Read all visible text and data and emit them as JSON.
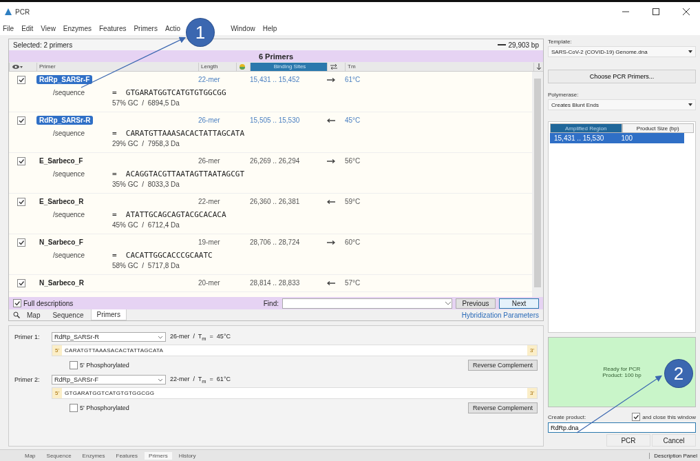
{
  "window": {
    "title": "PCR"
  },
  "menu": [
    "File",
    "Edit",
    "View",
    "Enzymes",
    "Features",
    "Primers",
    "Actio",
    "Window",
    "Help"
  ],
  "primer_list": {
    "selection": "Selected: 2 primers",
    "sequence_length": "29,903 bp",
    "heading": "6 Primers",
    "columns": [
      {
        "label": "Primer",
        "selected": false
      },
      {
        "label": "Length",
        "selected": false
      },
      {
        "label": "Binding Sites",
        "selected": true
      },
      {
        "label": "Tm",
        "selected": false
      }
    ],
    "rows": [
      {
        "name": "RdRp_SARSr-F",
        "selected": true,
        "checked": true,
        "length": "22-mer",
        "sites": "15,431 .. 15,452",
        "kind": "forward",
        "tm": "61°C",
        "sequence_label": "/sequence",
        "sequence": "=  GTGARATGGTCATGTGTGGCGG",
        "composition": "57% GC  /  6894,5 Da"
      },
      {
        "name": "RdRp_SARSr-R",
        "selected": true,
        "checked": true,
        "length": "26-mer",
        "sites": "15,505 .. 15,530",
        "kind": "reverse",
        "tm": "45°C",
        "sequence_label": "/sequence",
        "sequence": "=  CARATGTTAAASACACTATTAGCATA",
        "composition": "29% GC  /  7958,3 Da"
      },
      {
        "name": "E_Sarbeco_F",
        "selected": false,
        "checked": true,
        "length": "26-mer",
        "sites": "26,269 .. 26,294",
        "kind": "forward",
        "tm": "56°C",
        "sequence_label": "/sequence",
        "sequence": "=  ACAGGTACGTTAATAGTTAATAGCGT",
        "composition": "35% GC  /  8033,3 Da"
      },
      {
        "name": "E_Sarbeco_R",
        "selected": false,
        "checked": true,
        "length": "22-mer",
        "sites": "26,360 .. 26,381",
        "kind": "reverse",
        "tm": "59°C",
        "sequence_label": "/sequence",
        "sequence": "=  ATATTGCAGCAGTACGCACACA",
        "composition": "45% GC  /  6712,4 Da"
      },
      {
        "name": "N_Sarbeco_F",
        "selected": false,
        "checked": true,
        "length": "19-mer",
        "sites": "28,706 .. 28,724",
        "kind": "forward",
        "tm": "60°C",
        "sequence_label": "/sequence",
        "sequence": "=  CACATTGGCACCCGCAATC",
        "composition": "58% GC  /  5717,8 Da"
      },
      {
        "name": "N_Sarbeco_R",
        "selected": false,
        "checked": true,
        "length": "20-mer",
        "sites": "28,814 .. 28,833",
        "kind": "reverse",
        "tm": "57°C"
      }
    ],
    "full_descriptions": {
      "label": "Full descriptions",
      "checked": true
    },
    "find_label": "Find:",
    "buttons": [
      {
        "label": "Previous",
        "focused": false
      },
      {
        "label": "Next",
        "focused": true
      }
    ]
  },
  "view_tabs": [
    {
      "label": "Map",
      "selected": false
    },
    {
      "label": "Sequence",
      "selected": false
    },
    {
      "label": "Primers",
      "selected": true
    }
  ],
  "hybridization_link": "Hybridization Parameters",
  "primer_pair": [
    {
      "label": "Primer 1:",
      "value": "RdRp_SARSr-R",
      "info": "26-mer  /  T$_{m}$  =  45°C",
      "five_end": "5'",
      "sequence": "CARATGTTAAASACACTATTAGCATA",
      "three_end": "3'",
      "phosphorylated": {
        "label": "5' Phosphorylated",
        "checked": false
      },
      "button": "Reverse Complement"
    },
    {
      "label": "Primer 2:",
      "value": "RdRp_SARSr-F",
      "info": "22-mer  /  T$_{m}$  =  61°C",
      "five_end": "5'",
      "sequence": "GTGARATGGTCATGTGTGGCGG",
      "three_end": "3'",
      "phosphorylated": {
        "label": "5' Phosphorylated",
        "checked": false
      },
      "button": "Reverse Complement"
    }
  ],
  "bottom_tabs": [
    {
      "label": "Map",
      "selected": false
    },
    {
      "label": "Sequence",
      "selected": false
    },
    {
      "label": "Enzymes",
      "selected": false
    },
    {
      "label": "Features",
      "selected": false
    },
    {
      "label": "Primers",
      "selected": true
    },
    {
      "label": "History",
      "selected": false
    }
  ],
  "description_panel": "Description Panel",
  "pcr": {
    "template_label": "Template:",
    "template": "SARS-CoV-2 (COVID-19) Genome.dna",
    "choose_button": "Choose PCR Primers...",
    "polymerase_label": "Polymerase:",
    "polymerase": "Creates Blunt Ends",
    "product_columns": [
      {
        "label": "Amplified Region",
        "selected": true
      },
      {
        "label": "Product Size (bp)",
        "selected": false
      }
    ],
    "products": [
      {
        "region": "15,431 .. 15,530",
        "size": "100",
        "selected": true
      }
    ],
    "status": [
      "Ready for PCR",
      "Product:  100 bp"
    ],
    "create_label": "Create product:",
    "close_option": {
      "label": "and close this window",
      "checked": true
    },
    "product_name": "RdRp.dna",
    "buttons": [
      "PCR",
      "Cancel"
    ]
  },
  "callouts": [
    {
      "label": "1"
    },
    {
      "label": "2"
    }
  ]
}
